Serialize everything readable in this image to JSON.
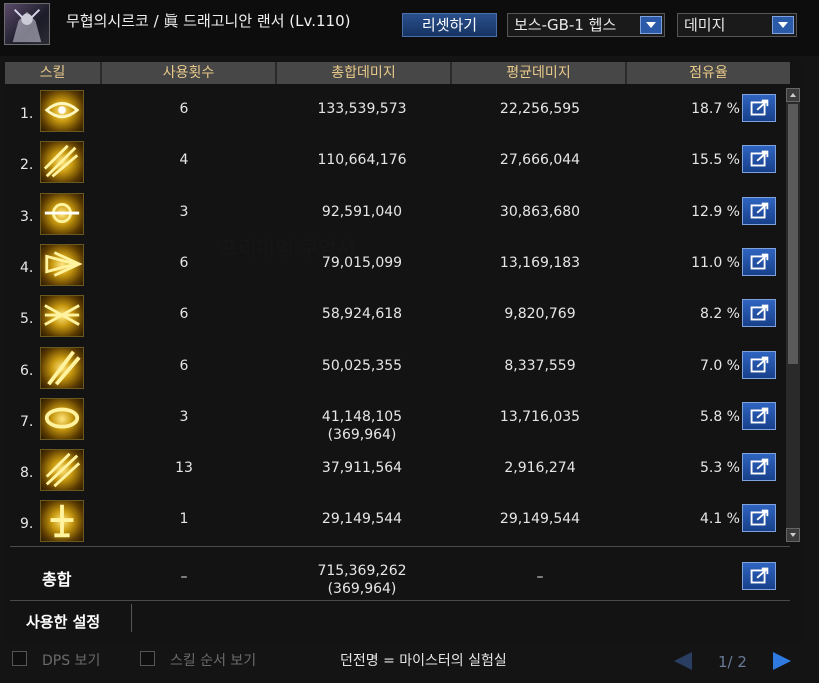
{
  "header": {
    "title": "무협의시르코 / 眞 드래고니안 랜서 (Lv.110)",
    "reset_label": "리셋하기",
    "dungeon_select": "보스-GB-1 헵스",
    "metric_select": "데미지"
  },
  "columns": [
    "스킬",
    "사용횟수",
    "총합데미지",
    "평균데미지",
    "점유율"
  ],
  "rows": [
    {
      "num": "1.",
      "icon": "skill-1-icon",
      "uses": "6",
      "total": "133,539,573",
      "total_sub": "",
      "avg": "22,256,595",
      "share": "18.7 %"
    },
    {
      "num": "2.",
      "icon": "skill-2-icon",
      "uses": "4",
      "total": "110,664,176",
      "total_sub": "",
      "avg": "27,666,044",
      "share": "15.5 %"
    },
    {
      "num": "3.",
      "icon": "skill-3-icon",
      "uses": "3",
      "total": "92,591,040",
      "total_sub": "",
      "avg": "30,863,680",
      "share": "12.9 %"
    },
    {
      "num": "4.",
      "icon": "skill-4-icon",
      "uses": "6",
      "total": "79,015,099",
      "total_sub": "",
      "avg": "13,169,183",
      "share": "11.0 %"
    },
    {
      "num": "5.",
      "icon": "skill-5-icon",
      "uses": "6",
      "total": "58,924,618",
      "total_sub": "",
      "avg": "9,820,769",
      "share": "8.2 %"
    },
    {
      "num": "6.",
      "icon": "skill-6-icon",
      "uses": "6",
      "total": "50,025,355",
      "total_sub": "",
      "avg": "8,337,559",
      "share": "7.0 %"
    },
    {
      "num": "7.",
      "icon": "skill-7-icon",
      "uses": "3",
      "total": "41,148,105",
      "total_sub": "(369,964)",
      "avg": "13,716,035",
      "share": "5.8 %"
    },
    {
      "num": "8.",
      "icon": "skill-8-icon",
      "uses": "13",
      "total": "37,911,564",
      "total_sub": "",
      "avg": "2,916,274",
      "share": "5.3 %"
    },
    {
      "num": "9.",
      "icon": "skill-9-icon",
      "uses": "1",
      "total": "29,149,544",
      "total_sub": "",
      "avg": "29,149,544",
      "share": "4.1 %"
    }
  ],
  "total": {
    "label": "총합",
    "uses": "–",
    "total": "715,369,262",
    "total_sub": "(369,964)",
    "avg": "–"
  },
  "settings_label": "사용한 설정",
  "footer": {
    "dps_label": "DPS 보기",
    "skill_order_label": "스킬 순서 보기",
    "dungeon_name": "던전명 = 마이스터의 실험실",
    "page": "1/ 2"
  },
  "colors": {
    "accent": "#2b5aa8",
    "header_text": "#e8c98a"
  }
}
